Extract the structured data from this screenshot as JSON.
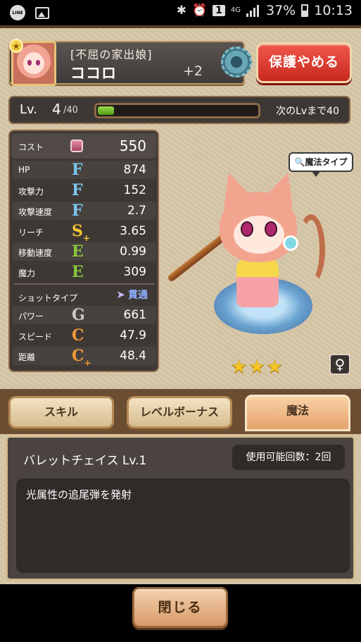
{
  "status_bar": {
    "left_icons": [
      "line-app-icon",
      "image-icon"
    ],
    "right_icons": [
      "bluetooth-icon",
      "alarm-icon",
      "notification-1-icon",
      "4g-icon",
      "signal-icon",
      "battery-icon"
    ],
    "badge": "1",
    "network": "4G",
    "battery": "37%",
    "time": "10:13"
  },
  "header": {
    "title": "[不屈の家出娘]",
    "name": "ココロ",
    "plus": "+2",
    "protect_button": "保護やめる"
  },
  "level": {
    "label": "Lv.",
    "value": "4",
    "max": "/40",
    "progress_fraction": 0.1,
    "next_text": "次のLvまで40"
  },
  "stats": {
    "cost": {
      "name": "コスト",
      "value": "550"
    },
    "rows": [
      {
        "name": "HP",
        "grade": "F",
        "plus": "",
        "value": "874"
      },
      {
        "name": "攻撃力",
        "grade": "F",
        "plus": "",
        "value": "152"
      },
      {
        "name": "攻撃速度",
        "grade": "F",
        "plus": "",
        "value": "2.7"
      },
      {
        "name": "リーチ",
        "grade": "S",
        "plus": "+",
        "value": "3.65"
      },
      {
        "name": "移動速度",
        "grade": "E",
        "plus": "",
        "value": "0.99"
      },
      {
        "name": "魔力",
        "grade": "E",
        "plus": "",
        "value": "309"
      }
    ],
    "shot_label": "ショットタイプ",
    "shot_type": "貫通",
    "shot_rows": [
      {
        "name": "パワー",
        "grade": "G",
        "plus": "",
        "value": "661"
      },
      {
        "name": "スピード",
        "grade": "C",
        "plus": "",
        "value": "47.9"
      },
      {
        "name": "距離",
        "grade": "C",
        "plus": "+",
        "value": "48.4"
      }
    ]
  },
  "character": {
    "type_tag": "魔法タイプ",
    "rarity_stars": 3,
    "gender_symbol": "♀"
  },
  "tabs": [
    {
      "label": "スキル",
      "active": false
    },
    {
      "label": "レベルボーナス",
      "active": false
    },
    {
      "label": "魔法",
      "active": true
    }
  ],
  "skill": {
    "name": "バレットチェイス Lv.1",
    "use_count": "使用可能回数：2回",
    "description": "光属性の追尾弾を発射"
  },
  "footer": {
    "close_button": "閉じる"
  },
  "colors": {
    "grade_F": "#7ac9ef",
    "grade_S": "#f1c42e",
    "grade_E": "#89c93e",
    "grade_G": "#c9c9c9",
    "grade_C": "#f19a36",
    "protect_button": "#e0413a",
    "level_fill": "#7cc232"
  }
}
